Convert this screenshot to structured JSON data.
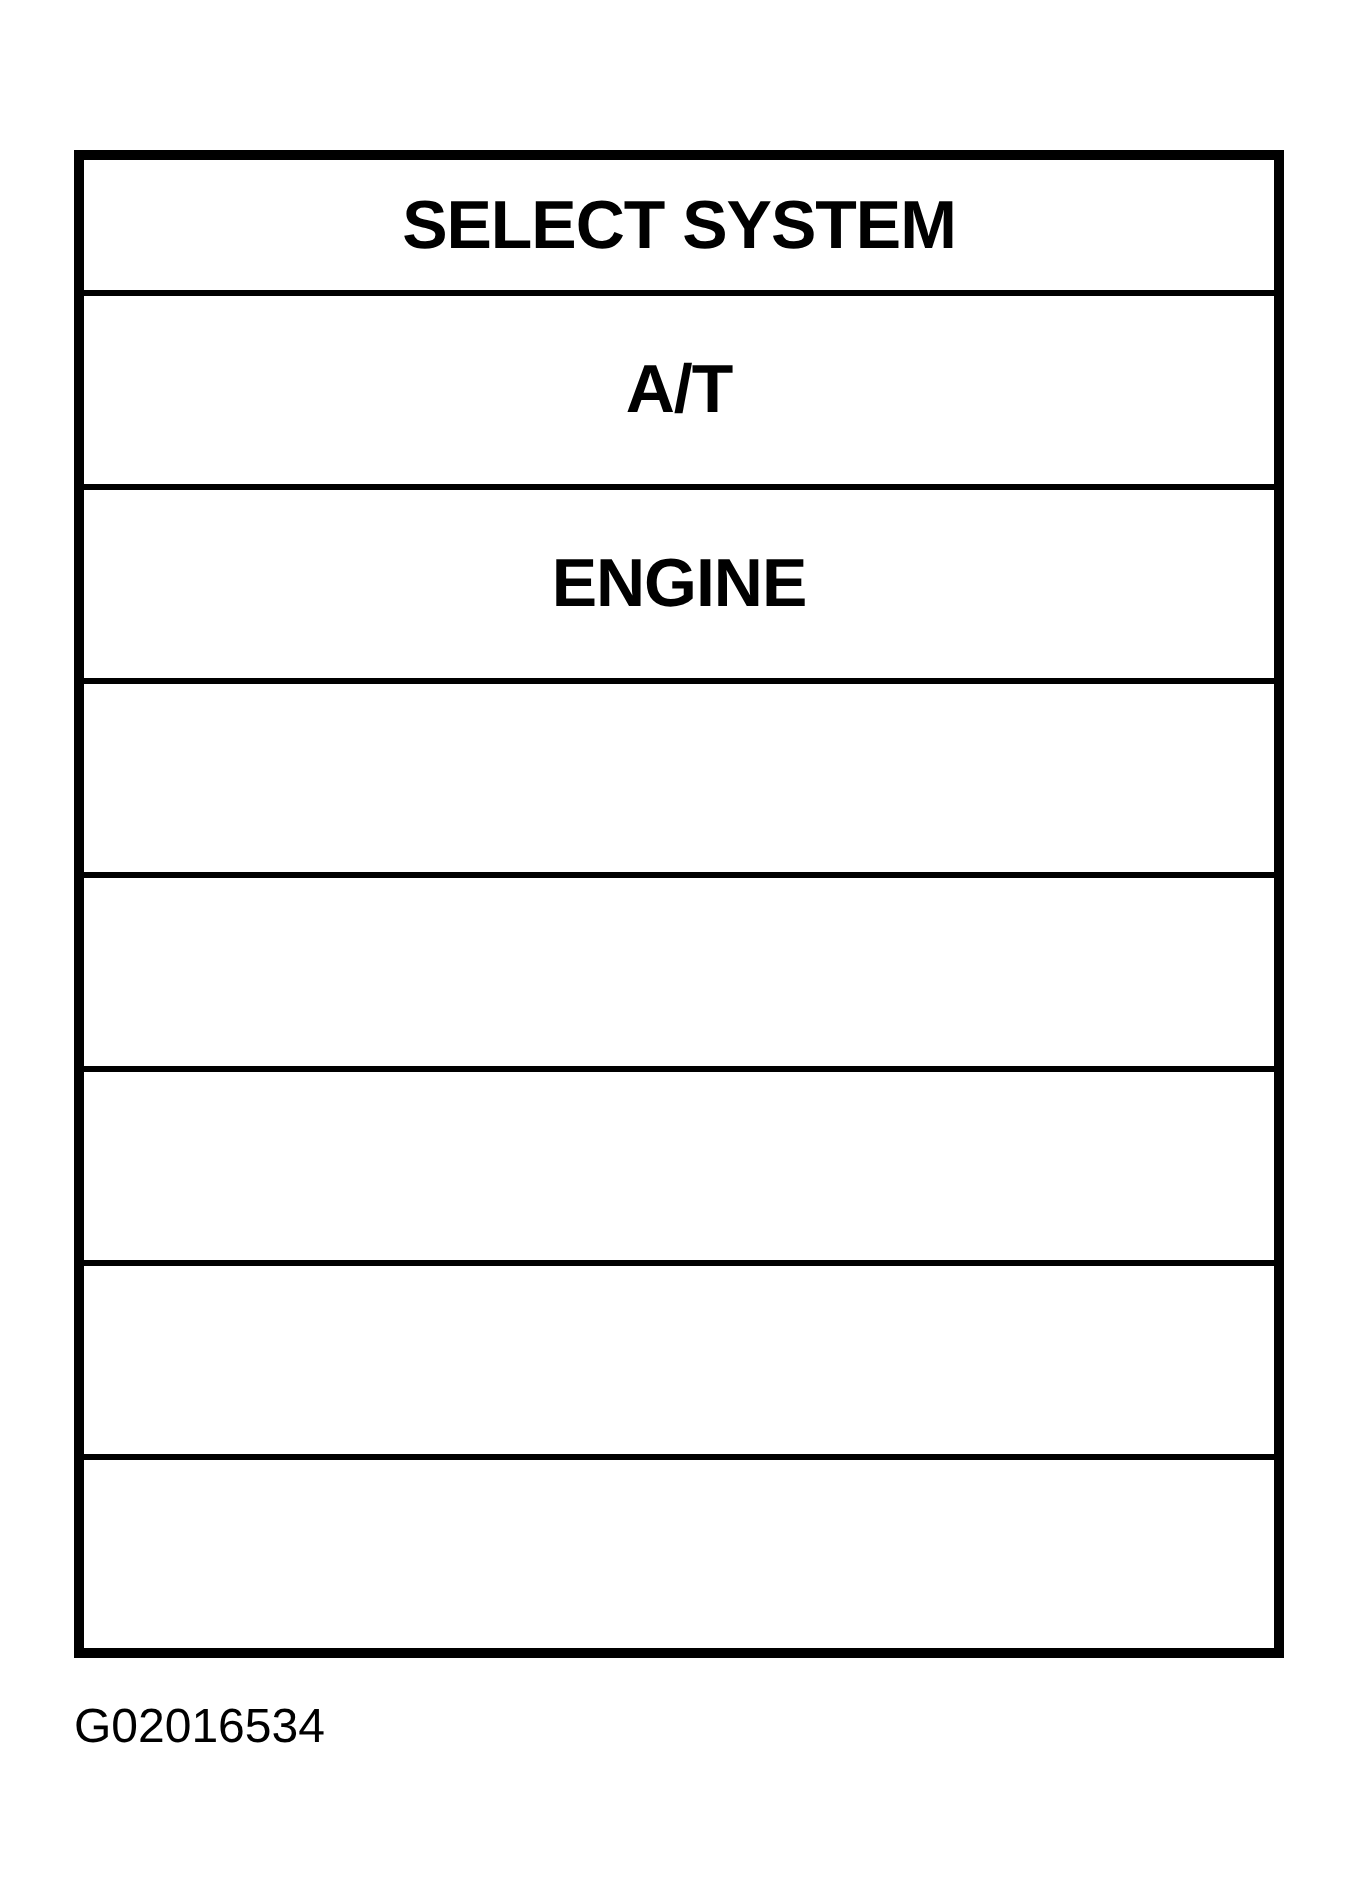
{
  "screen": {
    "title": "SELECT SYSTEM",
    "rows": [
      {
        "kind": "option",
        "label": "A/T"
      },
      {
        "kind": "option",
        "label": "ENGINE"
      },
      {
        "kind": "empty"
      },
      {
        "kind": "empty"
      },
      {
        "kind": "empty"
      },
      {
        "kind": "empty"
      },
      {
        "kind": "empty"
      }
    ]
  },
  "figure_code": "G02016534"
}
